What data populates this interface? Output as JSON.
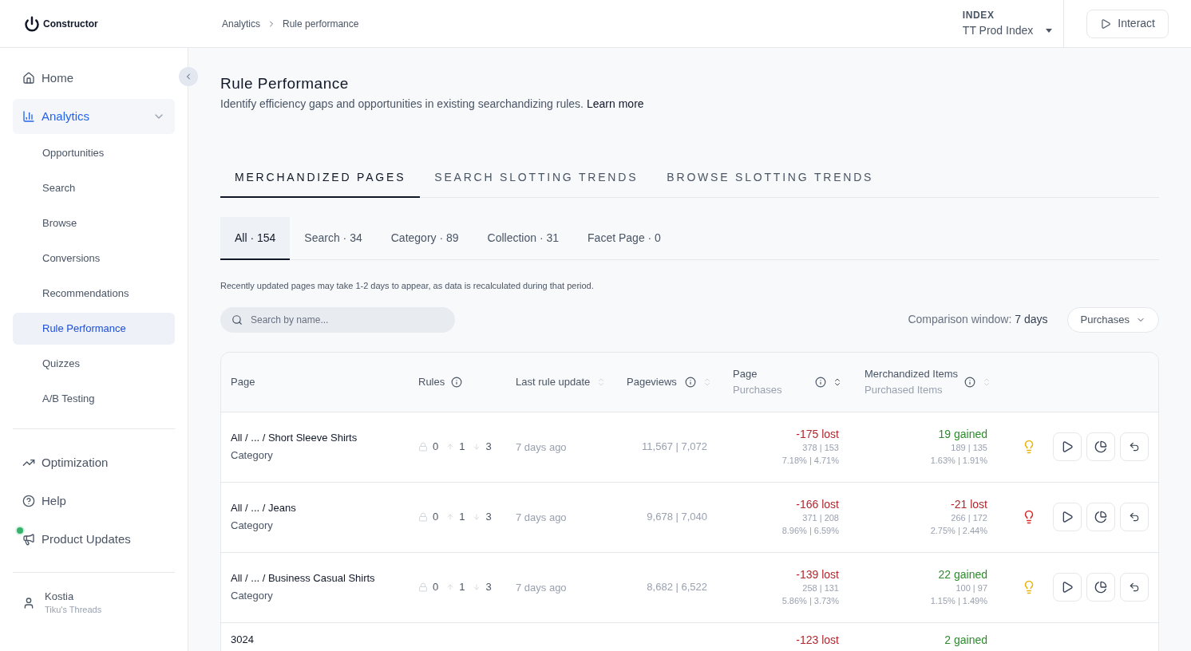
{
  "header": {
    "logo": "Constructor",
    "breadcrumb": [
      "Analytics",
      "Rule performance"
    ],
    "index_label": "INDEX",
    "index_value": "TT Prod Index",
    "interact_button": "Interact"
  },
  "sidebar": {
    "items": [
      {
        "label": "Home",
        "selected": false
      },
      {
        "label": "Analytics",
        "selected": false,
        "expanded": true,
        "children": [
          {
            "label": "Opportunities",
            "selected": false
          },
          {
            "label": "Search",
            "selected": false
          },
          {
            "label": "Browse",
            "selected": false
          },
          {
            "label": "Conversions",
            "selected": false
          },
          {
            "label": "Recommendations",
            "selected": false
          },
          {
            "label": "Rule Performance",
            "selected": true
          },
          {
            "label": "Quizzes",
            "selected": false
          },
          {
            "label": "A/B Testing",
            "selected": false
          }
        ]
      }
    ],
    "secondary": [
      {
        "label": "Optimization",
        "notification": false
      },
      {
        "label": "Help",
        "notification": false
      },
      {
        "label": "Product Updates",
        "notification": true
      }
    ],
    "user": {
      "name": "Kostia",
      "org": "Tiku's Threads"
    }
  },
  "page": {
    "title": "Rule Performance",
    "description": "Identify efficiency gaps and opportunities in existing searchandizing rules.",
    "learn_more": "Learn more"
  },
  "main_tabs": [
    {
      "label": "MERCHANDIZED PAGES",
      "selected": true
    },
    {
      "label": "SEARCH SLOTTING TRENDS",
      "selected": false
    },
    {
      "label": "BROWSE SLOTTING TRENDS",
      "selected": false
    }
  ],
  "filter_tabs": [
    {
      "label": "All · 154",
      "selected": true
    },
    {
      "label": "Search · 34",
      "selected": false
    },
    {
      "label": "Category · 89",
      "selected": false
    },
    {
      "label": "Collection · 31",
      "selected": false
    },
    {
      "label": "Facet Page · 0",
      "selected": false
    }
  ],
  "notice": "Recently updated pages may take 1-2 days to appear, as data is recalculated during that period.",
  "search": {
    "placeholder": "Search by name..."
  },
  "comparison": {
    "label": "Comparison window:",
    "value": "7 days"
  },
  "metric_dropdown": "Purchases",
  "table": {
    "columns": [
      {
        "label": "Page",
        "info": false,
        "sortable": false
      },
      {
        "label": "Rules",
        "info": true,
        "sortable": false
      },
      {
        "label": "Last rule update",
        "info": false,
        "sortable": true,
        "sort_active": false
      },
      {
        "label": "Pageviews",
        "info": true,
        "sortable": true,
        "sort_active": false
      },
      {
        "label": "Page",
        "sublabel": "Purchases",
        "info": true,
        "sortable": true,
        "sort_active": true
      },
      {
        "label": "Merchandized Items",
        "sublabel": "Purchased Items",
        "info": true,
        "sortable": true,
        "sort_active": false
      }
    ],
    "rows": [
      {
        "page": "All / ... / Short Sleeve Shirts",
        "type": "Category",
        "rules": [
          "0",
          "1",
          "3"
        ],
        "last_update": "7 days ago",
        "pageviews": "11,567 | 7,072",
        "purchases": {
          "delta": "-175 lost",
          "positive": false,
          "counts": "378 | 153",
          "rates": "7.18% | 4.71%"
        },
        "items": {
          "delta": "19 gained",
          "positive": true,
          "counts": "189 | 135",
          "rates": "1.63% | 1.91%"
        },
        "color": "#eab308"
      },
      {
        "page": "All / ... / Jeans",
        "type": "Category",
        "rules": [
          "0",
          "1",
          "3"
        ],
        "last_update": "7 days ago",
        "pageviews": "9,678 | 7,040",
        "purchases": {
          "delta": "-166 lost",
          "positive": false,
          "counts": "371 | 208",
          "rates": "8.96% | 6.59%"
        },
        "items": {
          "delta": "-21 lost",
          "positive": false,
          "counts": "266 | 172",
          "rates": "2.75% | 2.44%"
        },
        "color": "#dc2626"
      },
      {
        "page": "All / ... / Business Casual Shirts",
        "type": "Category",
        "rules": [
          "0",
          "1",
          "3"
        ],
        "last_update": "7 days ago",
        "pageviews": "8,682 | 6,522",
        "purchases": {
          "delta": "-139 lost",
          "positive": false,
          "counts": "258 | 131",
          "rates": "5.86% | 3.73%"
        },
        "items": {
          "delta": "22 gained",
          "positive": true,
          "counts": "100 | 97",
          "rates": "1.15% | 1.49%"
        },
        "color": "#eab308"
      },
      {
        "page": "3024",
        "purchases": {
          "delta": "-123 lost",
          "positive": false
        },
        "items": {
          "delta": "2 gained",
          "positive": true
        }
      }
    ]
  }
}
